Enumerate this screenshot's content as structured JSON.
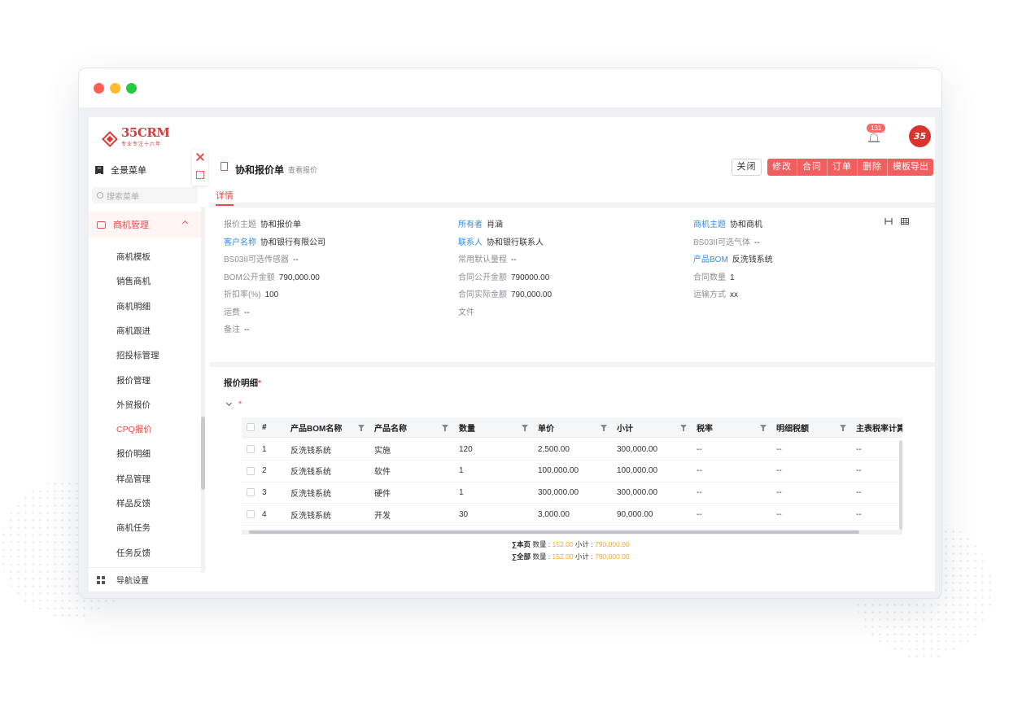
{
  "brand": {
    "name": "35CRM",
    "tagline": "专业专注十六年",
    "avatar_text": "35"
  },
  "notifications": {
    "count": "131"
  },
  "sidebar": {
    "all_menu": "全景菜单",
    "search_placeholder": "搜索菜单",
    "group_label": "商机管理",
    "items": [
      "商机模板",
      "销售商机",
      "商机明细",
      "商机跟进",
      "招投标管理",
      "报价管理",
      "外贸报价",
      "CPQ报价",
      "报价明细",
      "样品管理",
      "样品反馈",
      "商机任务",
      "任务反馈"
    ],
    "active_item": "CPQ报价",
    "nav_settings": "导航设置"
  },
  "header": {
    "title": "协和报价单",
    "subtitle": "查看报价",
    "close_label": "关闭",
    "actions": [
      "修改",
      "合同",
      "订单",
      "删除",
      "模板导出"
    ]
  },
  "tabs": [
    "详情"
  ],
  "fields": {
    "col1": [
      {
        "label": "报价主题",
        "value": "协和报价单"
      },
      {
        "label": "客户名称",
        "value": "协和银行有限公司"
      },
      {
        "label": "BS03II可选传感器",
        "value": "--"
      },
      {
        "label": "BOM公开金额",
        "value": "790,000.00"
      },
      {
        "label": "折扣率(%)",
        "value": "100"
      },
      {
        "label": "运费",
        "value": "--"
      },
      {
        "label": "备注",
        "value": "--"
      }
    ],
    "col2": [
      {
        "label": "所有者",
        "value": "肖涵"
      },
      {
        "label": "联系人",
        "value": "协和银行联系人"
      },
      {
        "label": "常用默认量程",
        "value": "--"
      },
      {
        "label": "合同公开金额",
        "value": "790000.00"
      },
      {
        "label": "合同实际金额",
        "value": "790,000.00"
      },
      {
        "label": "文件",
        "value": ""
      }
    ],
    "col3": [
      {
        "label": "商机主题",
        "value": "协和商机"
      },
      {
        "label": "BS03II可选气体",
        "value": "--"
      },
      {
        "label": "产品BOM",
        "value": "反洗钱系统"
      },
      {
        "label": "合同数量",
        "value": "1"
      },
      {
        "label": "运输方式",
        "value": "xx"
      }
    ]
  },
  "section": {
    "title": "报价明细",
    "required_mark": "*"
  },
  "table": {
    "columns": [
      "#",
      "产品BOM名称",
      "产品名称",
      "数量",
      "单价",
      "小计",
      "税率",
      "明细税额",
      "主表税率计算"
    ],
    "rows": [
      [
        "1",
        "反洗钱系统",
        "实施",
        "120",
        "2,500.00",
        "300,000.00",
        "--",
        "--",
        "--"
      ],
      [
        "2",
        "反洗钱系统",
        "软件",
        "1",
        "100,000.00",
        "100,000.00",
        "--",
        "--",
        "--"
      ],
      [
        "3",
        "反洗钱系统",
        "硬件",
        "1",
        "300,000.00",
        "300,000.00",
        "--",
        "--",
        "--"
      ],
      [
        "4",
        "反洗钱系统",
        "开发",
        "30",
        "3,000.00",
        "90,000.00",
        "--",
        "--",
        "--"
      ]
    ]
  },
  "summary": {
    "page_label": "∑本页",
    "all_label": "∑全部",
    "qty_label": "数量 :",
    "subtotal_label": "小计 :",
    "page_qty": "152.00",
    "page_subtotal": "790,000.00",
    "all_qty": "152.00",
    "all_subtotal": "790,000.00"
  },
  "colors": {
    "accent": "#f25d5d",
    "link": "#2f8cf0",
    "amount": "#f5a623"
  }
}
